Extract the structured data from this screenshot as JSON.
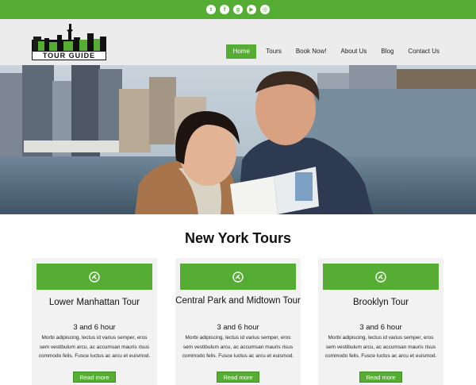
{
  "colors": {
    "accent": "#55ae33",
    "header_bg": "#ececec",
    "card_bg": "#f2f2f2"
  },
  "social": [
    {
      "name": "twitter-icon",
      "glyph": "t"
    },
    {
      "name": "facebook-icon",
      "glyph": "f"
    },
    {
      "name": "google-plus-icon",
      "glyph": "g"
    },
    {
      "name": "youtube-icon",
      "glyph": "▶"
    },
    {
      "name": "instagram-icon",
      "glyph": "◎"
    }
  ],
  "logo": {
    "text": "TOUR GUIDE"
  },
  "nav": {
    "items": [
      {
        "label": "Home"
      },
      {
        "label": "Tours"
      },
      {
        "label": "Book Now!"
      },
      {
        "label": "About Us"
      },
      {
        "label": "Blog"
      },
      {
        "label": "Contact Us"
      }
    ]
  },
  "main": {
    "title": "New York Tours",
    "cards": [
      {
        "title": "Lower Manhattan Tour",
        "sub": "3 and 6 hour",
        "desc": "Morbi adipiscing, lectus id varius semper, eros sem vestibulum arcu, ac accumsan mauris risus commodo felis. Fusce luctus ac arcu et euismod.",
        "button": "Read more"
      },
      {
        "title": "Central Park and Midtown Tour",
        "sub": "3 and 6 hour",
        "desc": "Morbi adipiscing, lectus id varius semper, eros sem vestibulum arcu, ac accumsan mauris risus commodo felis. Fusce luctus ac arcu et euismod.",
        "button": "Read more"
      },
      {
        "title": "Brooklyn Tour",
        "sub": "3 and 6 hour",
        "desc": "Morbi adipiscing, lectus id varius semper, eros sem vestibulum arcu, ac accumsan mauris risus commodo felis. Fusce luctus ac arcu et euismod.",
        "button": "Read more"
      }
    ]
  }
}
